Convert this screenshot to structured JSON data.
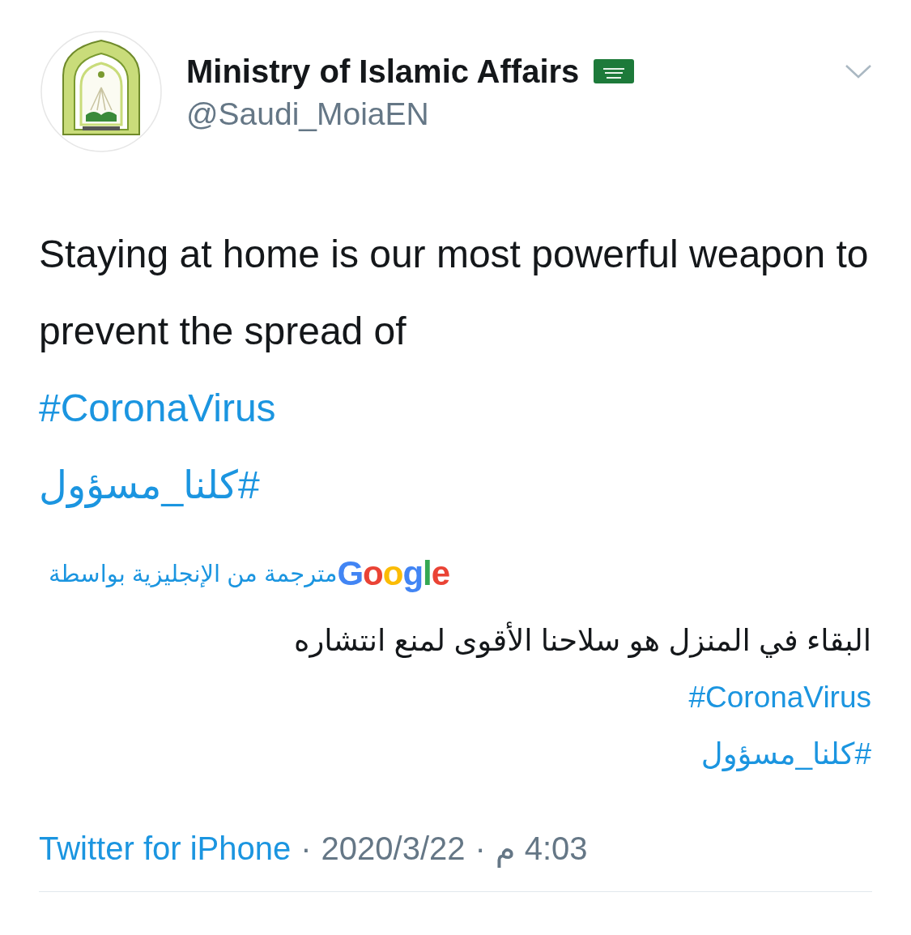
{
  "author": {
    "name": "Ministry of Islamic Affairs",
    "handle": "@Saudi_MoiaEN"
  },
  "tweet": {
    "lines": [
      {
        "kind": "text",
        "text": "Staying at home is our most powerful weapon to prevent the spread of"
      },
      {
        "kind": "hashtag",
        "text": "#CoronaVirus"
      },
      {
        "kind": "hashtag",
        "text": "#كلنا_مسؤول"
      }
    ]
  },
  "translation": {
    "label": "مترجمة من الإنجليزية بواسطة",
    "provider": "Google",
    "lines": [
      {
        "kind": "text",
        "text": "البقاء في المنزل هو سلاحنا الأقوى لمنع انتشاره"
      },
      {
        "kind": "hashtag",
        "text": "#CoronaVirus"
      },
      {
        "kind": "hashtag",
        "text": "#كلنا_مسؤول"
      }
    ]
  },
  "footer": {
    "source": "Twitter for iPhone",
    "separator_1": "·",
    "date": "2020/3/22",
    "separator_2": "·",
    "time": "4:03 م"
  }
}
